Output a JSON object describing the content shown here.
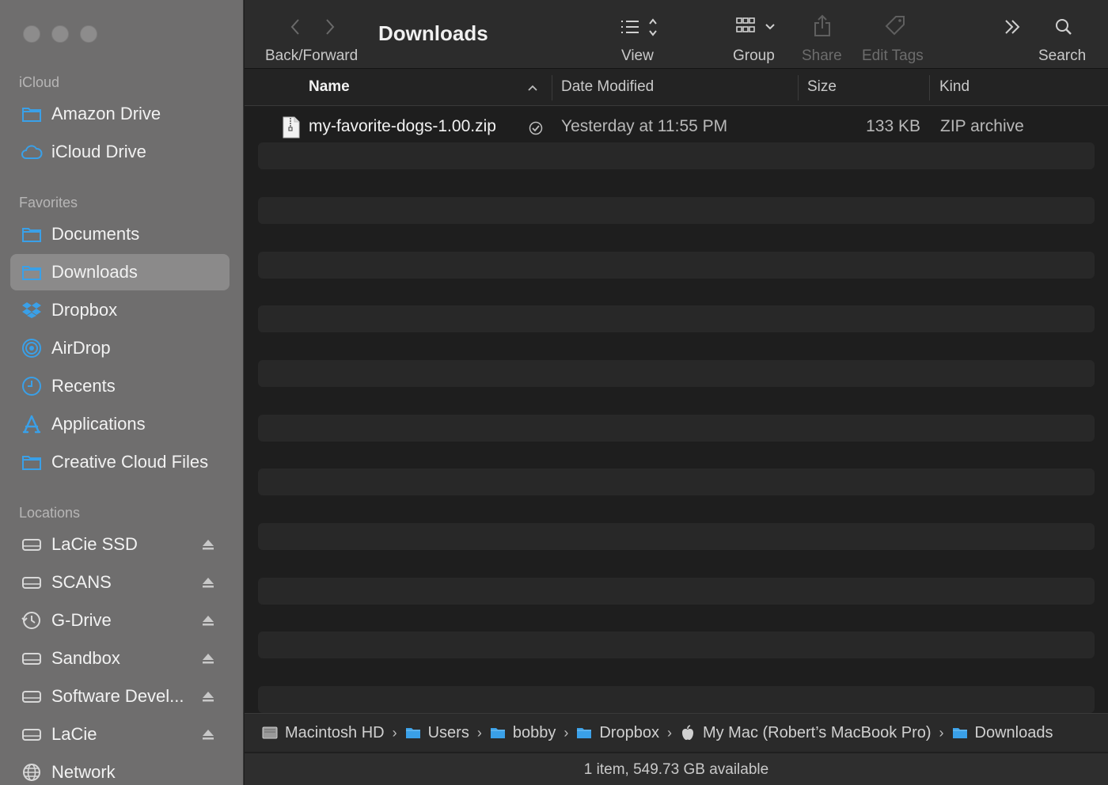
{
  "window": {
    "title": "Downloads"
  },
  "sidebar": {
    "sections": [
      {
        "title": "iCloud",
        "items": [
          {
            "label": "Amazon Drive",
            "icon": "folder-icon"
          },
          {
            "label": "iCloud Drive",
            "icon": "cloud-icon"
          }
        ]
      },
      {
        "title": "Favorites",
        "items": [
          {
            "label": "Documents",
            "icon": "folder-icon"
          },
          {
            "label": "Downloads",
            "icon": "folder-icon",
            "active": true
          },
          {
            "label": "Dropbox",
            "icon": "dropbox-icon"
          },
          {
            "label": "AirDrop",
            "icon": "airdrop-icon"
          },
          {
            "label": "Recents",
            "icon": "clock-icon"
          },
          {
            "label": "Applications",
            "icon": "applications-icon"
          },
          {
            "label": "Creative Cloud Files",
            "icon": "folder-icon"
          }
        ]
      },
      {
        "title": "Locations",
        "items": [
          {
            "label": "LaCie SSD",
            "icon": "drive-icon",
            "eject": true
          },
          {
            "label": "SCANS",
            "icon": "drive-icon",
            "eject": true
          },
          {
            "label": "G-Drive",
            "icon": "time-machine-icon",
            "eject": true
          },
          {
            "label": "Sandbox",
            "icon": "drive-icon",
            "eject": true
          },
          {
            "label": "Software Devel...",
            "icon": "drive-icon",
            "eject": true
          },
          {
            "label": "LaCie",
            "icon": "drive-icon",
            "eject": true
          },
          {
            "label": "Network",
            "icon": "network-icon"
          }
        ]
      }
    ]
  },
  "toolbar": {
    "back_forward_label": "Back/Forward",
    "view_label": "View",
    "group_label": "Group",
    "share_label": "Share",
    "edit_tags_label": "Edit Tags",
    "search_label": "Search"
  },
  "columns": {
    "name": "Name",
    "date_modified": "Date Modified",
    "size": "Size",
    "kind": "Kind"
  },
  "files": [
    {
      "name": "my-favorite-dogs-1.00.zip",
      "date_modified": "Yesterday at 11:55 PM",
      "size": "133 KB",
      "kind": "ZIP archive",
      "synced": true
    }
  ],
  "pathbar": {
    "crumbs": [
      {
        "label": "Macintosh HD",
        "icon": "hard-disk-icon"
      },
      {
        "label": "Users",
        "icon": "folder-icon"
      },
      {
        "label": "bobby",
        "icon": "folder-icon"
      },
      {
        "label": "Dropbox",
        "icon": "folder-icon"
      },
      {
        "label": "My Mac (Robert’s MacBook Pro)",
        "icon": "apple-icon"
      },
      {
        "label": "Downloads",
        "icon": "folder-icon"
      }
    ]
  },
  "status": {
    "text": "1 item, 549.73 GB available"
  },
  "colors": {
    "accent": "#3aa0e8",
    "sidebar_bg": "#6f6e6e",
    "content_bg": "#1e1e1e"
  }
}
